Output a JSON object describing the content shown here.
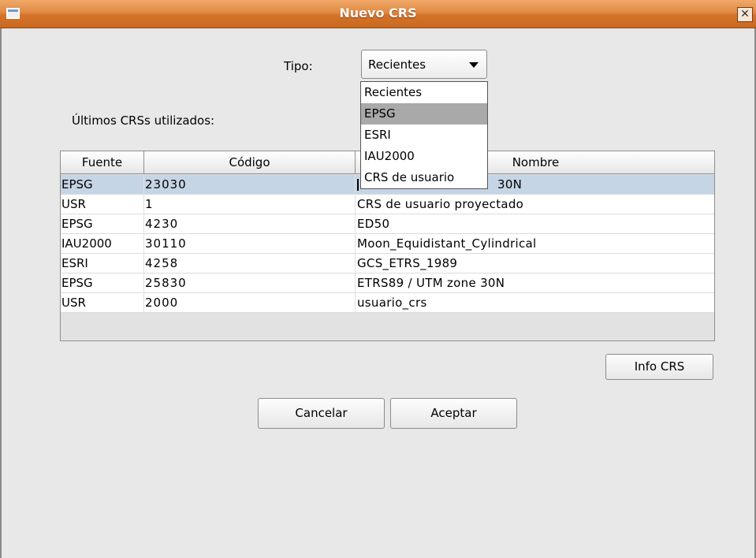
{
  "window": {
    "title": "Nuevo CRS",
    "close_glyph": "✕"
  },
  "tipo": {
    "label": "Tipo:",
    "selected": "Recientes",
    "options": [
      "Recientes",
      "EPSG",
      "ESRI",
      "IAU2000",
      "CRS de usuario"
    ],
    "highlighted": "EPSG"
  },
  "recent_label": "Últimos CRSs utilizados:",
  "table": {
    "headers": [
      "Fuente",
      "Código",
      "Nombre"
    ],
    "rows": [
      {
        "fuente": "EPSG",
        "codigo": "23030",
        "nombre": "ED50 / UTM zone 30N",
        "nombre_visible": "30N"
      },
      {
        "fuente": "USR",
        "codigo": "1",
        "nombre": "CRS de usuario proyectado"
      },
      {
        "fuente": "EPSG",
        "codigo": "4230",
        "nombre": "ED50"
      },
      {
        "fuente": "IAU2000",
        "codigo": "30110",
        "nombre": "Moon_Equidistant_Cylindrical"
      },
      {
        "fuente": "ESRI",
        "codigo": "4258",
        "nombre": "GCS_ETRS_1989"
      },
      {
        "fuente": "EPSG",
        "codigo": "25830",
        "nombre": "ETRS89 / UTM zone 30N"
      },
      {
        "fuente": "USR",
        "codigo": "2000",
        "nombre": "usuario_crs"
      }
    ],
    "selected_row": 0
  },
  "buttons": {
    "info": "Info CRS",
    "cancel": "Cancelar",
    "accept": "Aceptar"
  },
  "colors": {
    "titlebar": "#e08a43",
    "selection": "#c6d5e6",
    "dropdown_highlight": "#a9a9a9",
    "background": "#e8e8e8"
  }
}
